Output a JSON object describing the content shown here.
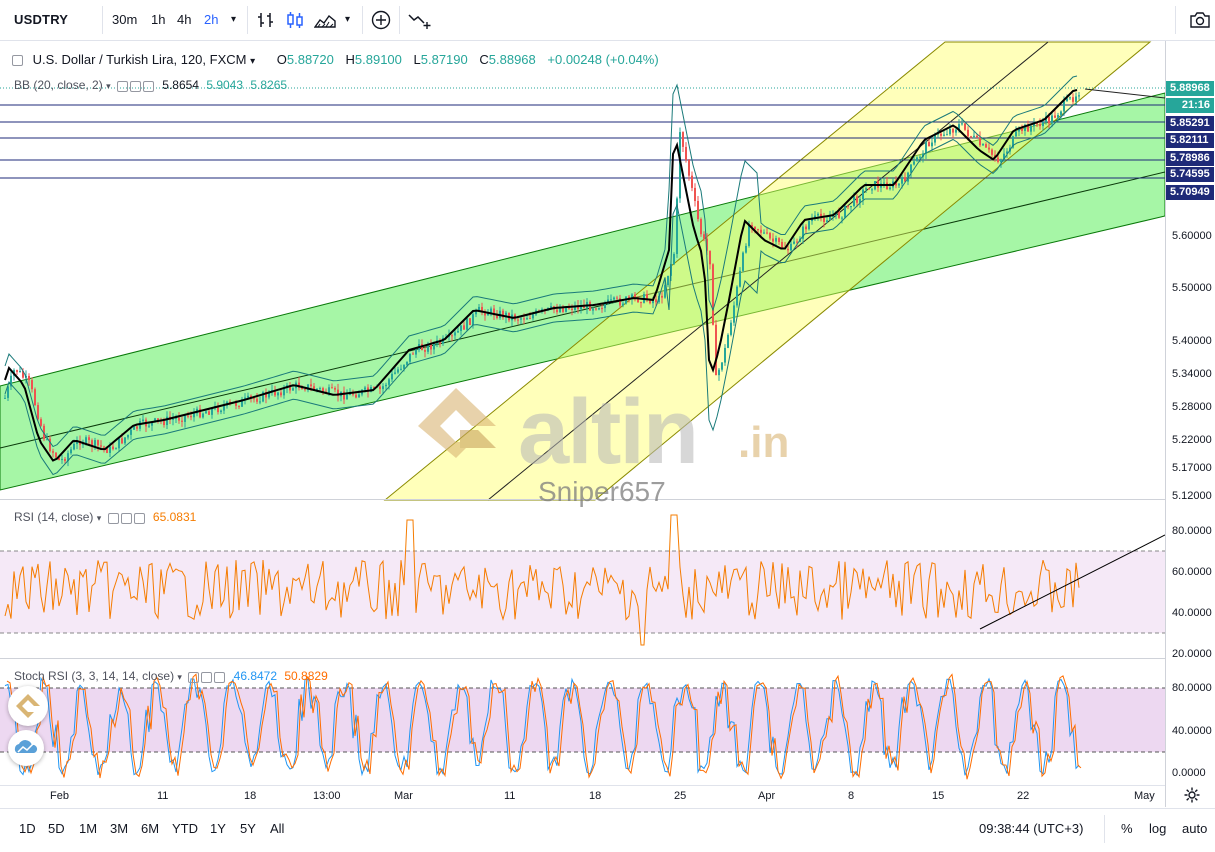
{
  "toolbar": {
    "symbol": "USDTRY",
    "intervals": [
      "30m",
      "1h",
      "4h",
      "2h"
    ],
    "active_interval": "2h"
  },
  "legend": {
    "title": "U.S. Dollar / Turkish Lira, 120, FXCM",
    "o_label": "O",
    "o_value": "5.88720",
    "h_label": "H",
    "h_value": "5.89100",
    "l_label": "L",
    "l_value": "5.87190",
    "c_label": "C",
    "c_value": "5.88968",
    "change": "+0.00248 (+0.04%)"
  },
  "bb": {
    "label": "BB (20, close, 2)",
    "basis": "5.8654",
    "upper": "5.9043",
    "lower": "5.8265"
  },
  "rsi": {
    "label": "RSI (14, close)",
    "value": "65.0831"
  },
  "stoch": {
    "label": "Stoch RSI (3, 3, 14, 14, close)",
    "k": "46.8472",
    "d": "50.8829"
  },
  "price_labels": [
    {
      "value": "5.88968",
      "bg": "#26a69a"
    },
    {
      "value": "21:16",
      "bg": "#26a69a"
    },
    {
      "value": "5.85291",
      "bg": "#1e2a78"
    },
    {
      "value": "5.82111",
      "bg": "#1e2a78"
    },
    {
      "value": "5.78986",
      "bg": "#1e2a78"
    },
    {
      "value": "5.74595",
      "bg": "#1e2a78"
    },
    {
      "value": "5.70949",
      "bg": "#1e2a78"
    }
  ],
  "price_axis": [
    "5.60000",
    "5.50000",
    "5.40000",
    "5.34000",
    "5.28000",
    "5.22000",
    "5.17000",
    "5.12000"
  ],
  "rsi_axis": [
    "80.0000",
    "60.0000",
    "40.0000",
    "20.0000"
  ],
  "stoch_axis": [
    "80.0000",
    "40.0000",
    "0.0000"
  ],
  "time_axis": [
    "Feb",
    "11",
    "18",
    "13:00",
    "Mar",
    "11",
    "18",
    "25",
    "Apr",
    "8",
    "15",
    "22",
    "May"
  ],
  "watermark": {
    "brand": "altin",
    "suffix": ".in",
    "user": "Sniper657"
  },
  "bottombar": {
    "ranges": [
      "1D",
      "5D",
      "1M",
      "3M",
      "6M",
      "YTD",
      "1Y",
      "5Y",
      "All"
    ],
    "clock": "09:38:44 (UTC+3)",
    "percent": "%",
    "log": "log",
    "auto": "auto"
  },
  "colors": {
    "accent": "#2962ff",
    "up": "#26a69a",
    "down": "#ef5350",
    "green_channel": "#00e600",
    "yellow_channel": "#ffff66",
    "rsi": "#f57c00",
    "stoch_k": "#2196f3",
    "stoch_d": "#ff6d00"
  },
  "icons": [
    "candles-icon",
    "indicators-icon",
    "add-icon",
    "compare-icon",
    "camera-icon",
    "settings-icon"
  ]
}
